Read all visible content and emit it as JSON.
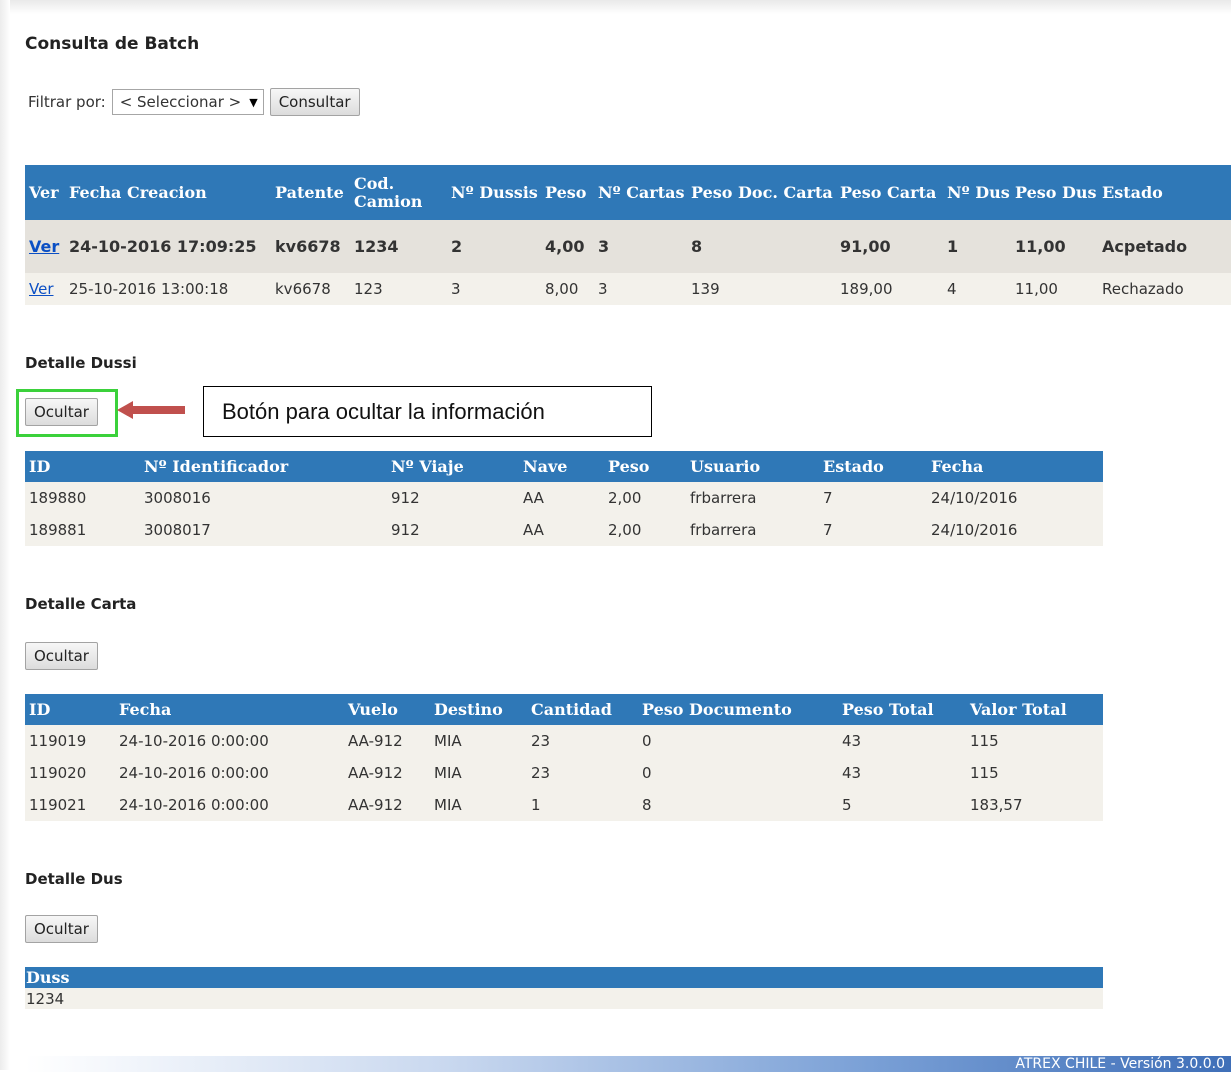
{
  "page": {
    "title": "Consulta de Batch"
  },
  "filter": {
    "label": "Filtrar por:",
    "selected": "< Seleccionar >",
    "button": "Consultar"
  },
  "batch_table": {
    "headers": [
      "Ver",
      "Fecha Creacion",
      "Patente",
      "Cod. Camion",
      "Nº Dussis",
      "Peso",
      "Nº Cartas",
      "Peso Doc. Carta",
      "Peso Carta",
      "Nº Dus",
      "Peso Dus",
      "Estado"
    ],
    "rows": [
      [
        "Ver",
        "24-10-2016 17:09:25",
        "kv6678",
        "1234",
        "2",
        "4,00",
        "3",
        "8",
        "91,00",
        "1",
        "11,00",
        "Acpetado"
      ],
      [
        "Ver",
        "25-10-2016 13:00:18",
        "kv6678",
        "123",
        "3",
        "8,00",
        "3",
        "139",
        "189,00",
        "4",
        "11,00",
        "Rechazado"
      ]
    ]
  },
  "detalle_dussi": {
    "title": "Detalle Dussi",
    "button": "Ocultar",
    "headers": [
      "ID",
      "Nº Identificador",
      "Nº Viaje",
      "Nave",
      "Peso",
      "Usuario",
      "Estado",
      "Fecha"
    ],
    "rows": [
      [
        "189880",
        "3008016",
        "912",
        "AA",
        "2,00",
        "frbarrera",
        "7",
        "24/10/2016"
      ],
      [
        "189881",
        "3008017",
        "912",
        "AA",
        "2,00",
        "frbarrera",
        "7",
        "24/10/2016"
      ]
    ]
  },
  "callout": {
    "text": "Botón para ocultar la información"
  },
  "detalle_carta": {
    "title": "Detalle Carta",
    "button": "Ocultar",
    "headers": [
      "ID",
      "Fecha",
      "Vuelo",
      "Destino",
      "Cantidad",
      "Peso Documento",
      "Peso Total",
      "Valor Total"
    ],
    "rows": [
      [
        "119019",
        "24-10-2016 0:00:00",
        "AA-912",
        "MIA",
        "23",
        "0",
        "43",
        "115"
      ],
      [
        "119020",
        "24-10-2016 0:00:00",
        "AA-912",
        "MIA",
        "23",
        "0",
        "43",
        "115"
      ],
      [
        "119021",
        "24-10-2016 0:00:00",
        "AA-912",
        "MIA",
        "1",
        "8",
        "5",
        "183,57"
      ]
    ]
  },
  "detalle_dus": {
    "title": "Detalle Dus",
    "button": "Ocultar",
    "headers": [
      "Duss"
    ],
    "rows": [
      [
        "1234"
      ]
    ]
  },
  "footer": {
    "text": "ATREX CHILE - Versión 3.0.0.0"
  },
  "colors": {
    "header_bg": "#2f78b7",
    "highlight_box": "#3bd13b",
    "arrow": "#c0504d",
    "link": "#0b4fc4"
  }
}
